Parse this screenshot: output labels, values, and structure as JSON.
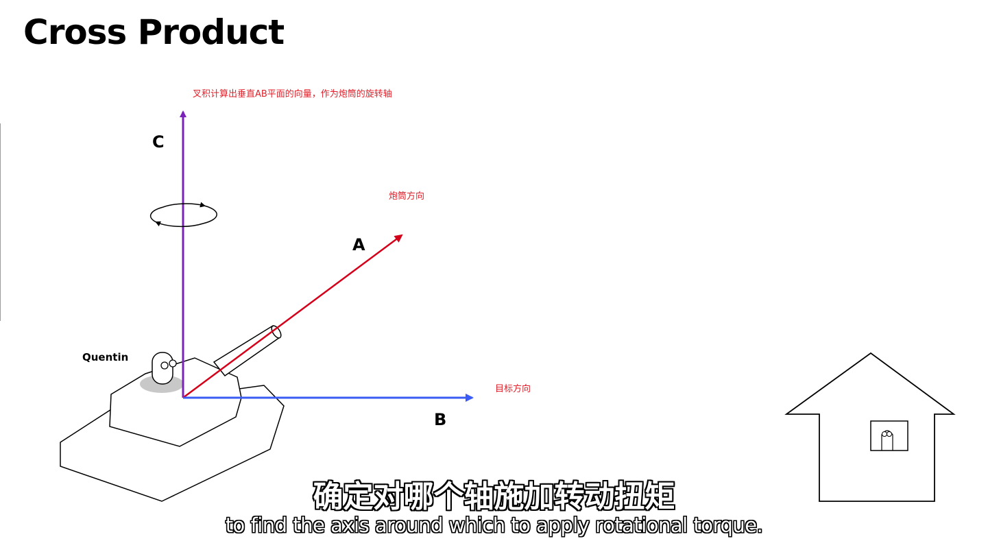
{
  "title": "Cross Product",
  "labels": {
    "c": "C",
    "a": "A",
    "b": "B",
    "character": "Quentin"
  },
  "annotations": {
    "cross_product_note": "叉积计算出垂直AB平面的向量，作为炮筒的旋转轴",
    "barrel_direction": "炮筒方向",
    "target_direction": "目标方向"
  },
  "subtitles": {
    "chinese": "确定对哪个轴施加转动扭矩",
    "english": "to find the axis around which to apply rotational torque."
  },
  "colors": {
    "vector_c": "#7b22b8",
    "vector_a": "#d4001a",
    "vector_b": "#3a5cf5",
    "annotation": "#e0202a"
  }
}
